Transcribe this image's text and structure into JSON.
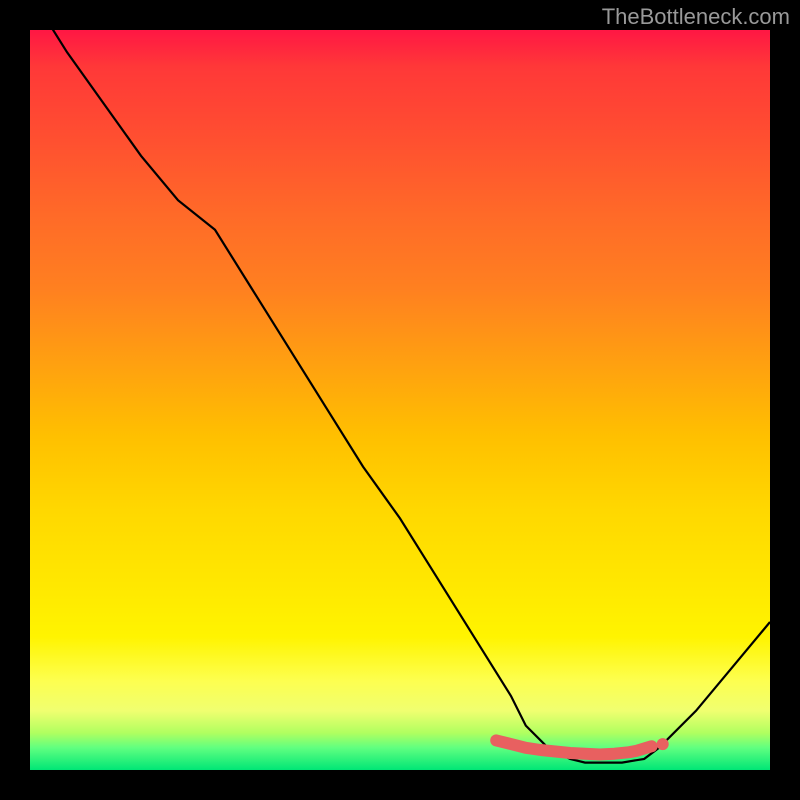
{
  "attribution": "TheBottleneck.com",
  "chart_data": {
    "type": "line",
    "title": "",
    "xlabel": "",
    "ylabel": "",
    "xlim": [
      0,
      100
    ],
    "ylim": [
      0,
      100
    ],
    "x": [
      0,
      5,
      10,
      15,
      20,
      25,
      30,
      35,
      40,
      45,
      50,
      55,
      60,
      65,
      67,
      70,
      73,
      75,
      78,
      80,
      83,
      85,
      90,
      95,
      100
    ],
    "y": [
      105,
      97,
      90,
      83,
      77,
      73,
      65,
      57,
      49,
      41,
      34,
      26,
      18,
      10,
      6,
      3,
      1.5,
      1,
      1,
      1,
      1.5,
      3,
      8,
      14,
      20
    ],
    "red_points": {
      "x": [
        63,
        65,
        67,
        69,
        71,
        73,
        75,
        77,
        79,
        81,
        82,
        84
      ],
      "y": [
        4,
        3.5,
        3,
        2.7,
        2.5,
        2.3,
        2.2,
        2.1,
        2.2,
        2.4,
        2.6,
        3.2
      ]
    },
    "gradient_stops": [
      {
        "pos": 0,
        "color": "#ff1744"
      },
      {
        "pos": 50,
        "color": "#ffc000"
      },
      {
        "pos": 90,
        "color": "#fdff50"
      },
      {
        "pos": 100,
        "color": "#00e676"
      }
    ]
  }
}
